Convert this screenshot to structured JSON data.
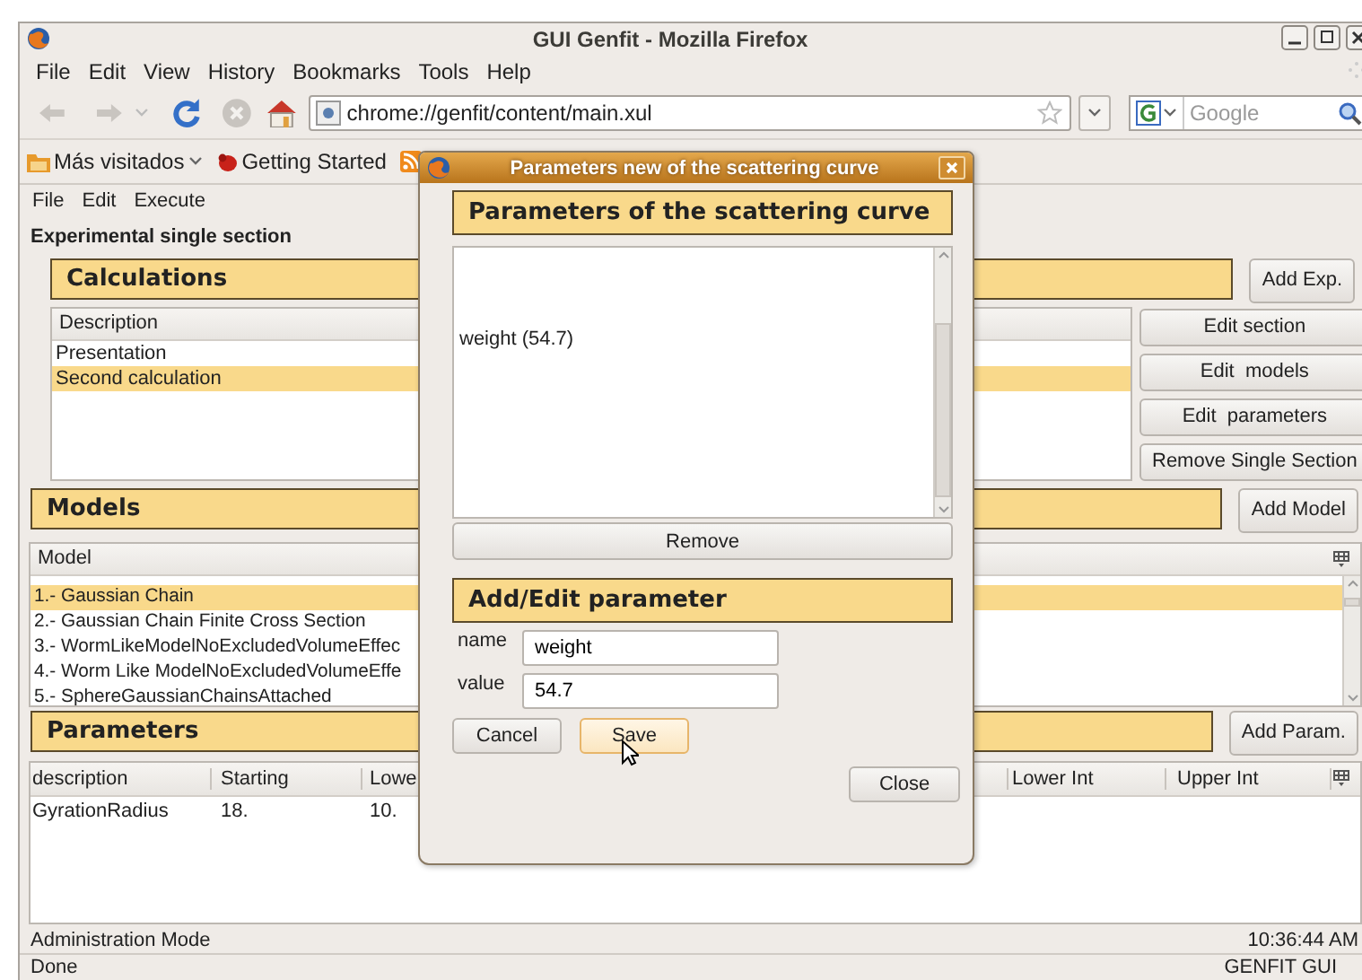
{
  "window": {
    "title": "GUI Genfit - Mozilla Firefox"
  },
  "menu": [
    "File",
    "Edit",
    "View",
    "History",
    "Bookmarks",
    "Tools",
    "Help"
  ],
  "address": {
    "value": "chrome://genfit/content/main.xul"
  },
  "search": {
    "placeholder": "Google"
  },
  "bookmarks": [
    {
      "kind": "folder",
      "label": "Más visitados"
    },
    {
      "kind": "page",
      "label": "Getting Started"
    },
    {
      "kind": "feed"
    }
  ],
  "app_menu": [
    "File",
    "Edit",
    "Execute"
  ],
  "section_title": "Experimental single section",
  "calculations": {
    "title": "Calculations",
    "add_button": "Add Exp.",
    "column": "Description",
    "rows": [
      {
        "label": "Presentation",
        "selected": false
      },
      {
        "label": "Second calculation",
        "selected": true
      }
    ],
    "buttons": [
      "Edit section",
      "Edit  models",
      "Edit  parameters",
      "Remove Single Section"
    ]
  },
  "models": {
    "title": "Models",
    "add_button": "Add Model",
    "column": "Model",
    "rows": [
      {
        "label": "1.- Gaussian Chain",
        "selected": true
      },
      {
        "label": "2.- Gaussian Chain Finite Cross Section",
        "selected": false
      },
      {
        "label": "3.- WormLikeModelNoExcludedVolumeEffec",
        "selected": false
      },
      {
        "label": "4.- Worm Like ModelNoExcludedVolumeEffe",
        "selected": false
      },
      {
        "label": "5.- SphereGaussianChainsAttached",
        "selected": false
      }
    ]
  },
  "parameters": {
    "title": "Parameters",
    "add_button": "Add Param.",
    "columns": [
      "description",
      "Starting",
      "Lowe",
      "Lower Int",
      "Upper Int"
    ],
    "rows": [
      [
        "GyrationRadius",
        "18.",
        "10."
      ]
    ]
  },
  "status": {
    "mode": "Administration Mode",
    "time": "10:36:44 AM",
    "state": "Done",
    "app": "GENFIT GUI"
  },
  "dialog": {
    "title": "Parameters new of the scattering curve",
    "list_title": "Parameters of the scattering curve",
    "items": [
      {
        "label": "weight (54.7)",
        "selected": false
      }
    ],
    "remove_button": "Remove",
    "edit_title": "Add/Edit parameter",
    "fields": [
      {
        "label": "name",
        "value": "weight"
      },
      {
        "label": "value",
        "value": "54.7"
      }
    ],
    "buttons": [
      {
        "label": "Cancel",
        "hovered": false
      },
      {
        "label": "Save",
        "hovered": true
      }
    ],
    "close_button": "Close"
  }
}
